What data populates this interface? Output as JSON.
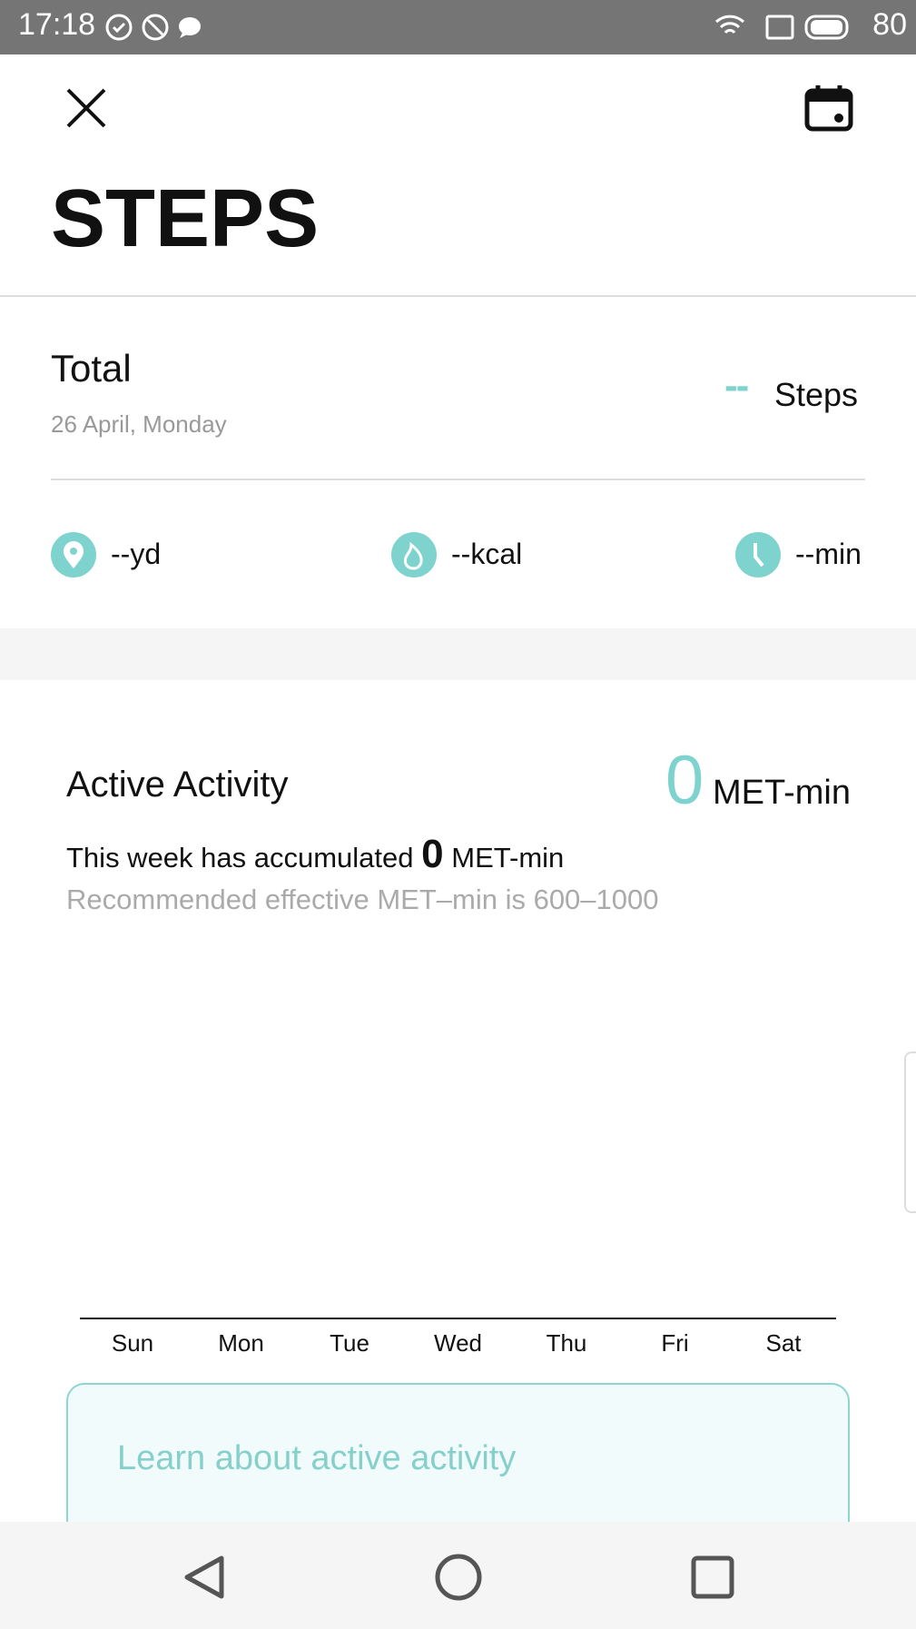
{
  "status_bar": {
    "time": "17:18",
    "battery": "80"
  },
  "header": {
    "title": "STEPS"
  },
  "summary": {
    "label": "Total",
    "date": "26 April, Monday",
    "value": "--",
    "unit": "Steps",
    "stats": [
      {
        "icon": "location-icon",
        "value": "--yd"
      },
      {
        "icon": "flame-icon",
        "value": "--kcal"
      },
      {
        "icon": "clock-icon",
        "value": "--min"
      }
    ]
  },
  "activity": {
    "title": "Active Activity",
    "value": "0",
    "unit": "MET-min",
    "week_prefix": "This week has accumulated",
    "week_value": "0",
    "week_unit": "MET-min",
    "recommendation": "Recommended effective MET–min is 600–1000",
    "days": [
      "Sun",
      "Mon",
      "Tue",
      "Wed",
      "Thu",
      "Fri",
      "Sat"
    ]
  },
  "learn_card": {
    "label": "Learn about active activity"
  },
  "colors": {
    "accent": "#7fd3cf"
  }
}
